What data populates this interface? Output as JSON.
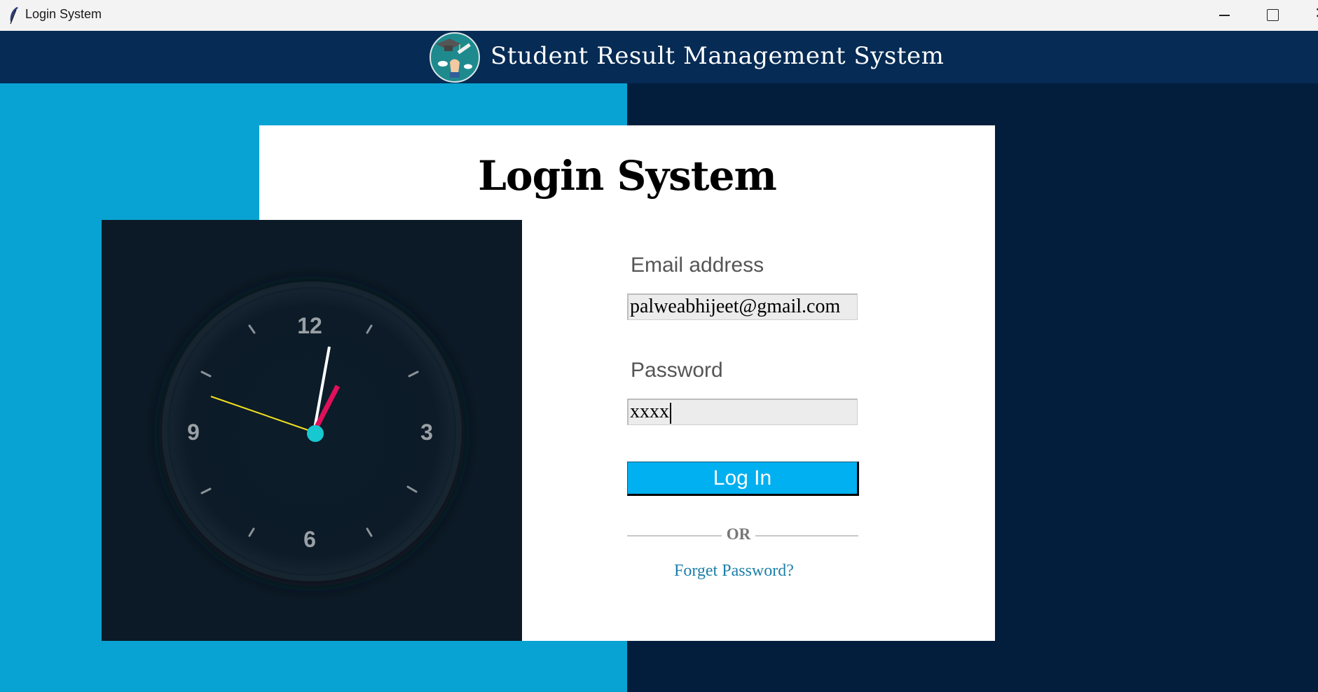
{
  "window": {
    "title": "Login System",
    "controls": {
      "minimize": "minimize-icon",
      "maximize": "maximize-icon",
      "close": "✕"
    }
  },
  "header": {
    "title": "Student Result Management System",
    "logo_icon": "graduation-logo-icon"
  },
  "login": {
    "heading": "Login System",
    "email_label": "Email address",
    "email_value": "palweabhijeet@gmail.com",
    "password_label": "Password",
    "password_value": "xxxx",
    "login_button": "Log In",
    "or_text": "OR",
    "forgot_link": "Forget Password?"
  },
  "clock": {
    "numerals": {
      "twelve": "12",
      "three": "3",
      "six": "6",
      "nine": "9"
    }
  },
  "colors": {
    "header_bg": "#062b54",
    "left_bg": "#09a3d3",
    "right_bg": "#031e3d",
    "button_bg": "#00b0f0",
    "link": "#1b7fa8",
    "clock_bg": "#0b1a26",
    "hour_hand": "#e0105a",
    "minute_hand": "#ffffff",
    "second_hand": "#f0e020",
    "clock_center": "#18c8d0"
  }
}
